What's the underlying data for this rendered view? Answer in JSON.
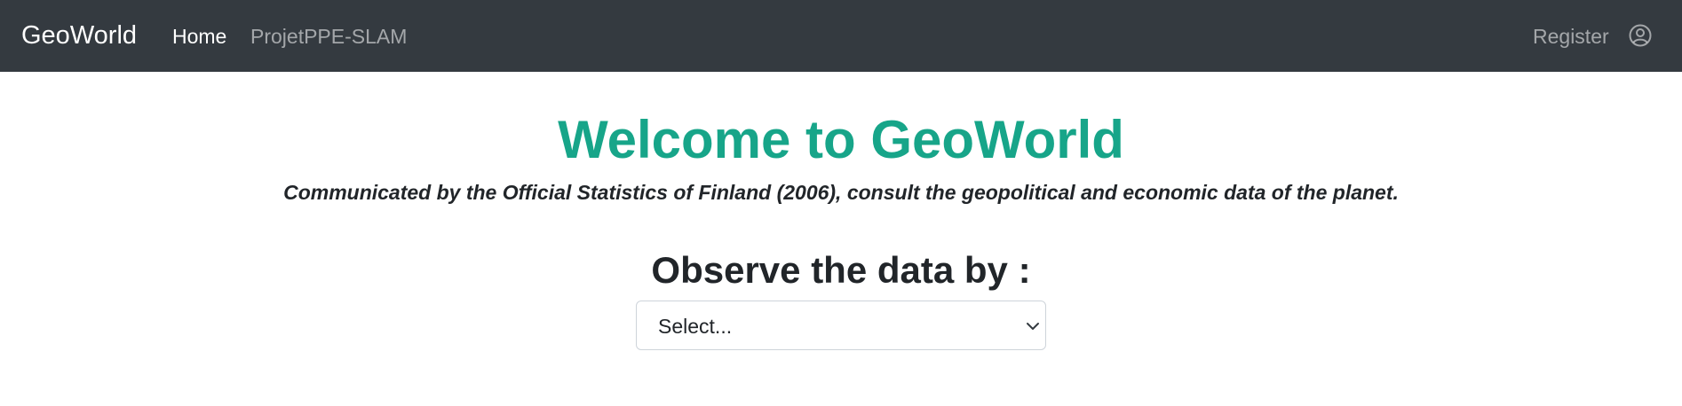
{
  "navbar": {
    "brand": "GeoWorld",
    "links": [
      {
        "label": "Home"
      },
      {
        "label": "ProjetPPE-SLAM"
      }
    ],
    "register_label": "Register",
    "user_icon": "user-circle-icon"
  },
  "hero": {
    "title": "Welcome to GeoWorld",
    "subtitle": "Communicated by the Official Statistics of Finland (2006), consult the geopolitical and economic data of the planet."
  },
  "observe": {
    "title": "Observe the data by :",
    "select_value": "Select...",
    "select_icon": "chevron-down-icon"
  },
  "colors": {
    "navbar_bg": "#343a40",
    "title_accent": "#17a589",
    "text": "#212529"
  }
}
